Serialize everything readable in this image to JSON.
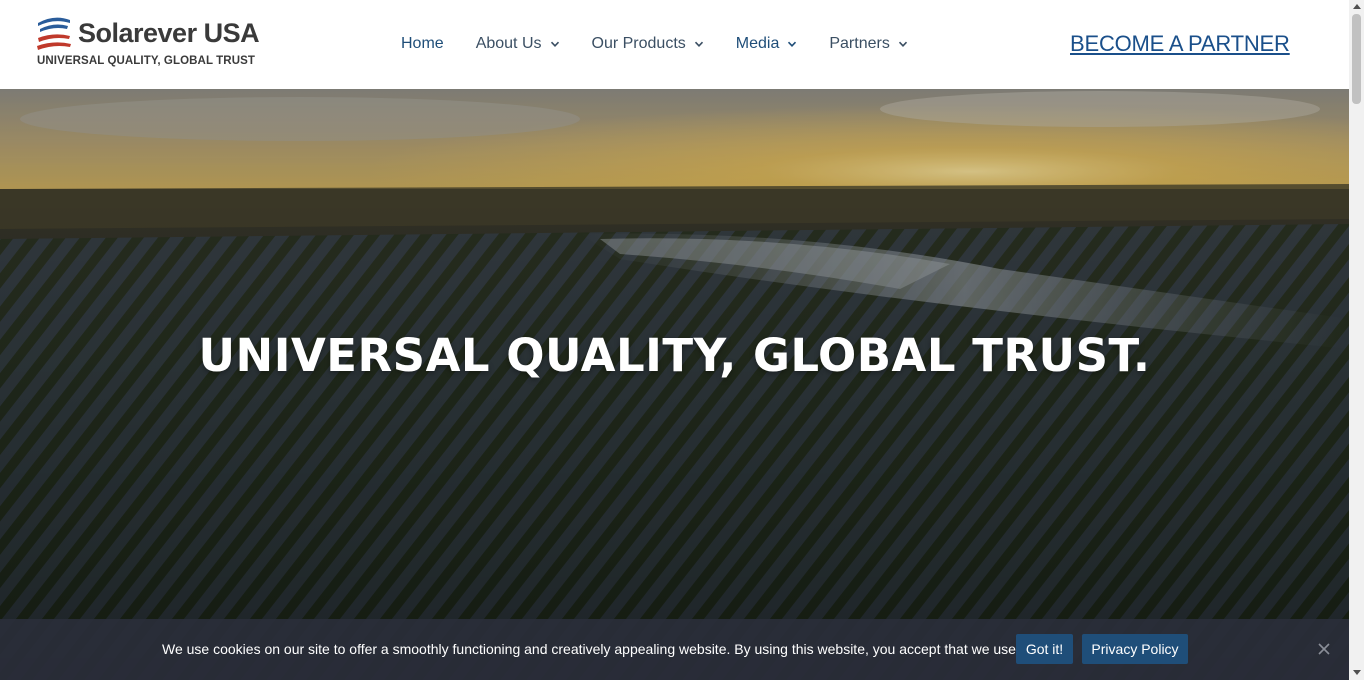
{
  "brand": {
    "name": "Solarever USA",
    "tagline": "UNIVERSAL QUALITY, GLOBAL TRUST",
    "colors": {
      "blue": "#2a5c9a",
      "red": "#c0392b",
      "gray": "#3a3a3a"
    }
  },
  "nav": {
    "items": [
      {
        "label": "Home",
        "has_dropdown": false
      },
      {
        "label": "About Us",
        "has_dropdown": true
      },
      {
        "label": "Our Products",
        "has_dropdown": true
      },
      {
        "label": "Media",
        "has_dropdown": true
      },
      {
        "label": "Partners",
        "has_dropdown": true
      }
    ],
    "cta_label": "BECOME A PARTNER",
    "accent": "#1a4f8a"
  },
  "hero": {
    "title": "UNIVERSAL QUALITY, GLOBAL TRUST."
  },
  "cookie": {
    "message": "We use cookies on our site to offer a smoothly functioning and creatively appealing website. By using this website, you accept that we use cookies.",
    "accept_label": "Got it!",
    "policy_label": "Privacy Policy",
    "close_icon": "close-icon"
  }
}
